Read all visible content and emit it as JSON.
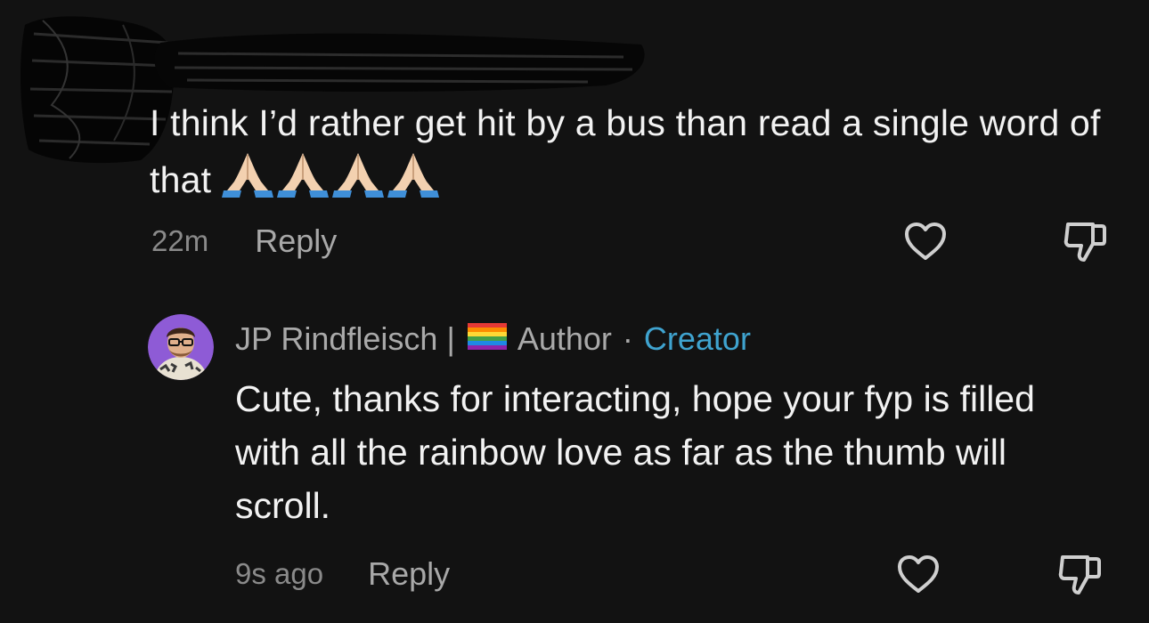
{
  "top_comment": {
    "text": "I think I’d rather get hit by a bus than read a single word of that",
    "emoji_name": "folded-hands-emoji",
    "emoji_count": 4,
    "time": "22m",
    "reply_label": "Reply"
  },
  "reply_comment": {
    "author": "JP Rindfleisch",
    "divider": "|",
    "badge_author": "Author",
    "separator": "·",
    "badge_creator": "Creator",
    "text": "Cute, thanks for interacting, hope your fyp is filled with all the rainbow love as far as the thumb will scroll.",
    "time": "9s ago",
    "reply_label": "Reply"
  },
  "colors": {
    "background": "#121212",
    "text": "#f2f2f2",
    "muted": "#8a8a8a",
    "creator_accent": "#3fa3cf",
    "avatar_ring": "#8e5bd6"
  },
  "icons": {
    "like": "heart-outline-icon",
    "dislike": "thumbs-down-outline-icon"
  }
}
